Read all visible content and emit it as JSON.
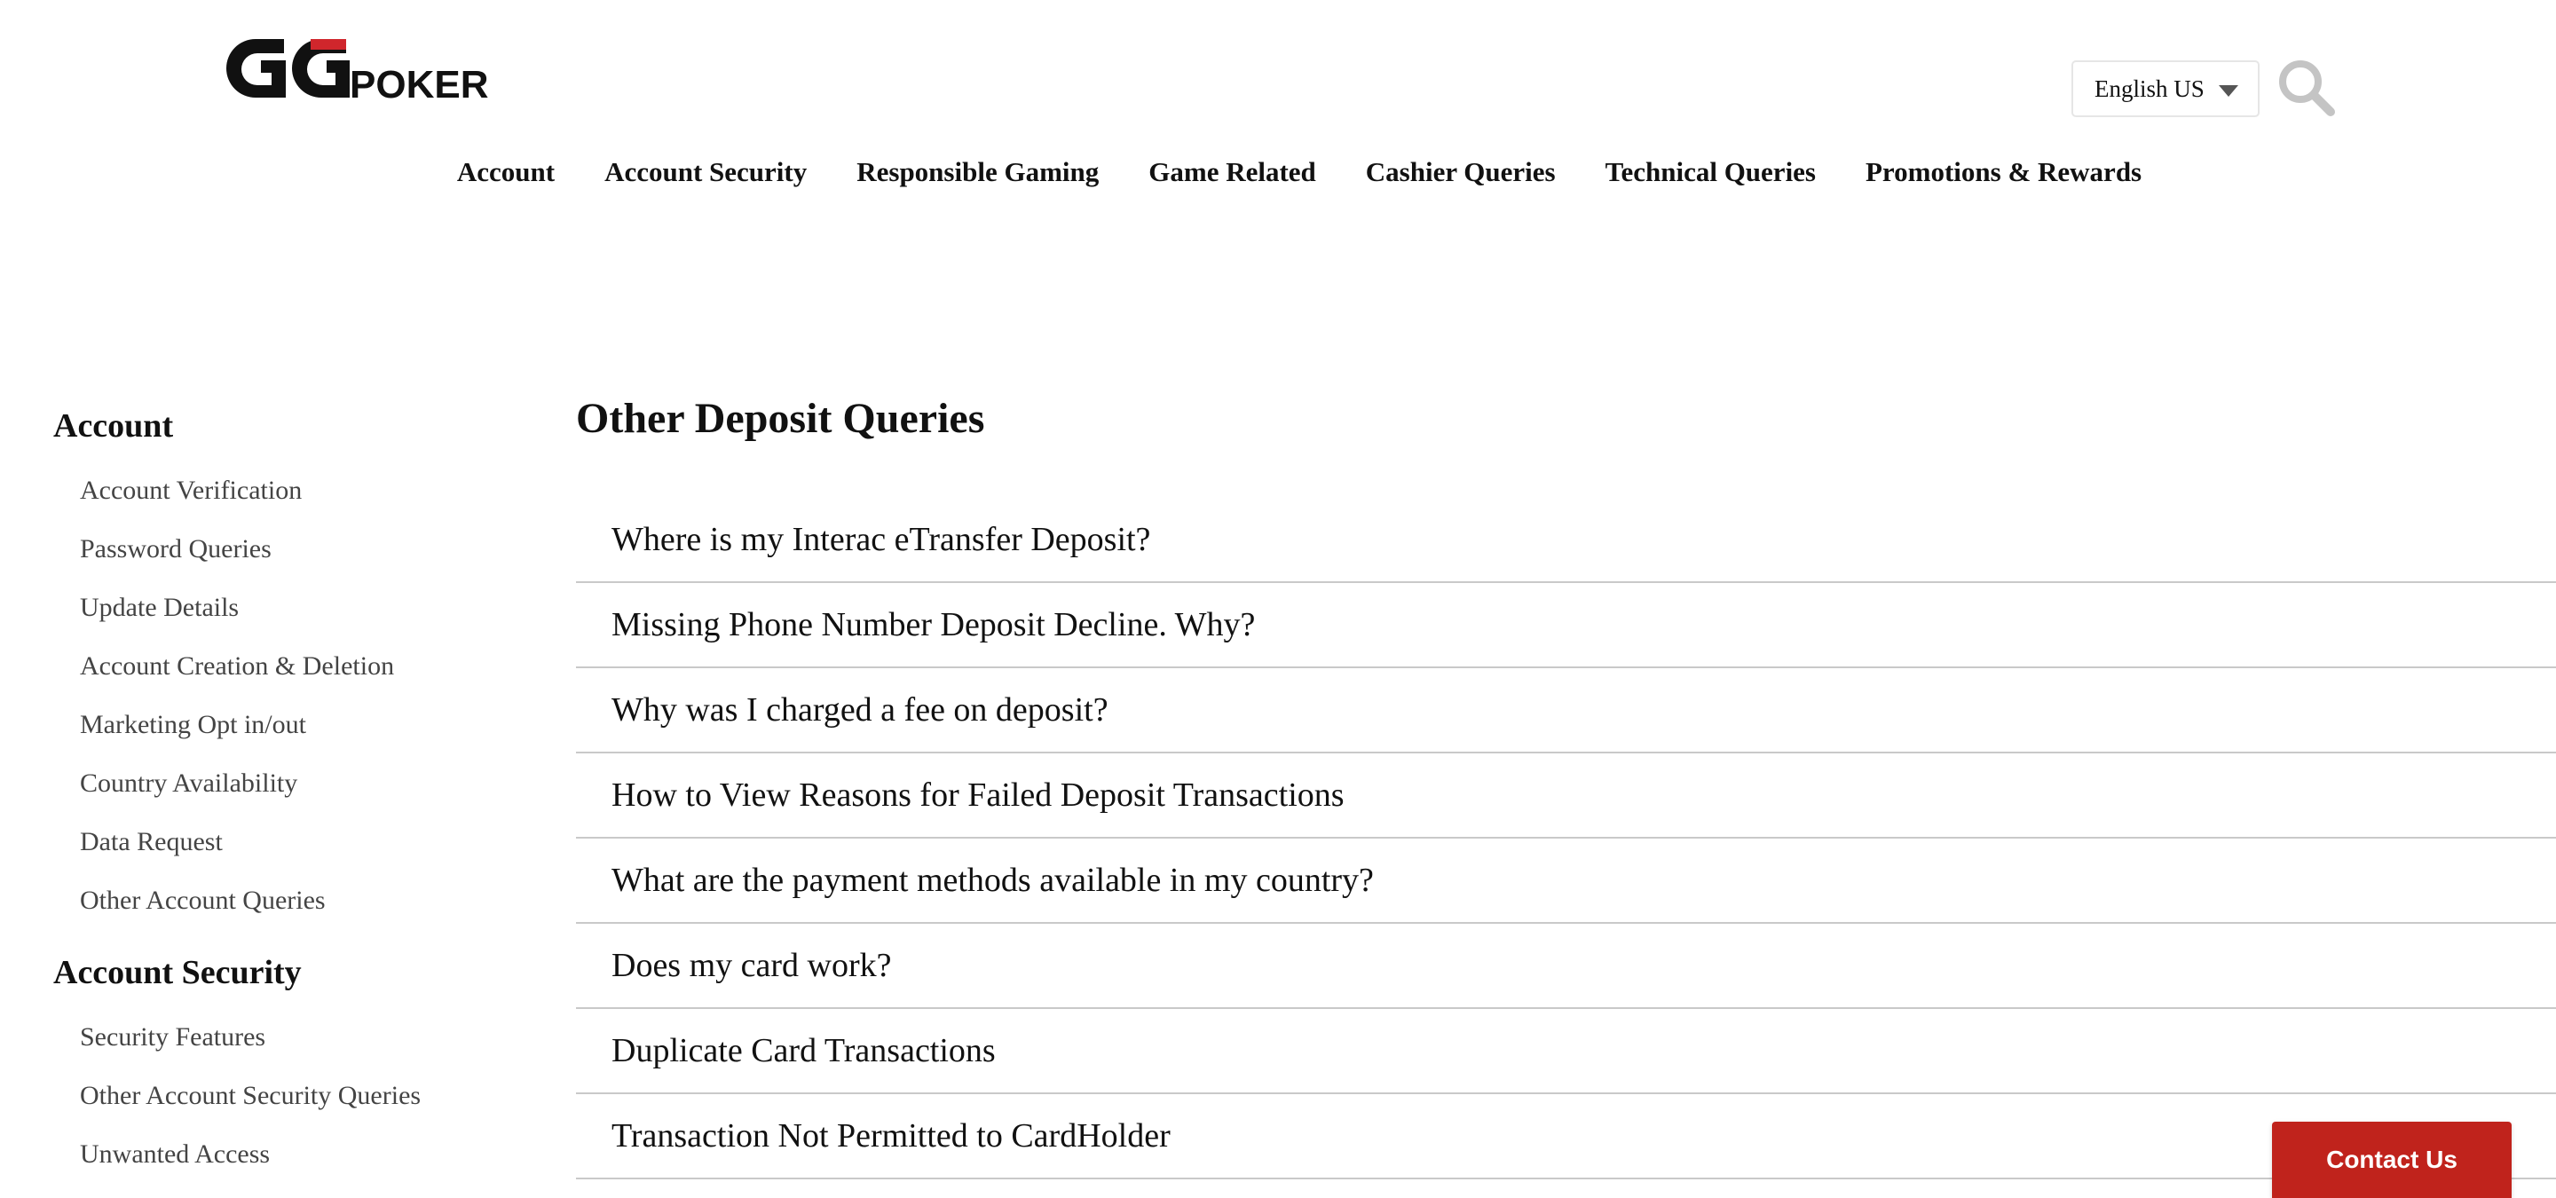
{
  "header": {
    "logo_text_main": "GG",
    "logo_text_sub": "POKER",
    "language": "English US",
    "colors": {
      "brand_red": "#d0262c",
      "logo_dark": "#111111"
    }
  },
  "top_nav": [
    {
      "label": "Account"
    },
    {
      "label": "Account Security"
    },
    {
      "label": "Responsible Gaming"
    },
    {
      "label": "Game Related"
    },
    {
      "label": "Cashier Queries"
    },
    {
      "label": "Technical Queries"
    },
    {
      "label": "Promotions & Rewards"
    }
  ],
  "sidebar": {
    "sections": [
      {
        "heading": "Account",
        "items": [
          "Account Verification",
          "Password Queries",
          "Update Details",
          "Account Creation & Deletion",
          "Marketing Opt in/out",
          "Country Availability",
          "Data Request",
          "Other Account Queries"
        ]
      },
      {
        "heading": "Account Security",
        "items": [
          "Security Features",
          "Other Account Security Queries",
          "Unwanted Access"
        ]
      }
    ]
  },
  "main": {
    "title": "Other Deposit Queries",
    "faqs": [
      "Where is my Interac eTransfer Deposit?",
      "Missing Phone Number Deposit Decline. Why?",
      "Why was I charged a fee on deposit?",
      "How to View Reasons for Failed Deposit Transactions",
      "What are the payment methods available in my country?",
      "Does my card work?",
      "Duplicate Card Transactions",
      "Transaction Not Permitted to CardHolder"
    ]
  },
  "contact": {
    "label": "Contact Us",
    "color": "#c0231c"
  },
  "icons": {
    "search": "search-icon",
    "language_caret": "chevron-down-icon"
  }
}
